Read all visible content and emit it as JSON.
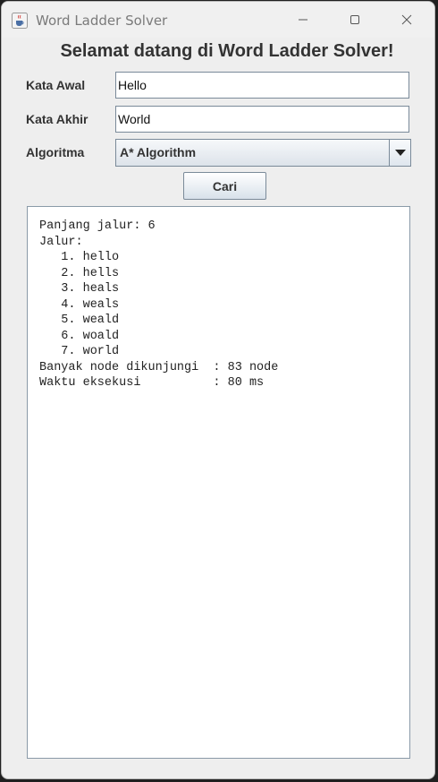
{
  "window": {
    "title": "Word Ladder Solver",
    "icon": "java-cup-icon"
  },
  "header": {
    "welcome": "Selamat datang di Word Ladder Solver!"
  },
  "form": {
    "start_label": "Kata Awal",
    "start_value": "Hello",
    "end_label": "Kata Akhir",
    "end_value": "World",
    "algorithm_label": "Algoritma",
    "algorithm_selected": "A* Algorithm",
    "search_button": "Cari"
  },
  "output": {
    "text": "Panjang jalur: 6\nJalur:\n   1. hello\n   2. hells\n   3. heals\n   4. weals\n   5. weald\n   6. woald\n   7. world\nBanyak node dikunjungi  : 83 node\nWaktu eksekusi          : 80 ms"
  },
  "colors": {
    "window_bg": "#eeeeee",
    "border": "#7a8a99",
    "text": "#333333"
  }
}
